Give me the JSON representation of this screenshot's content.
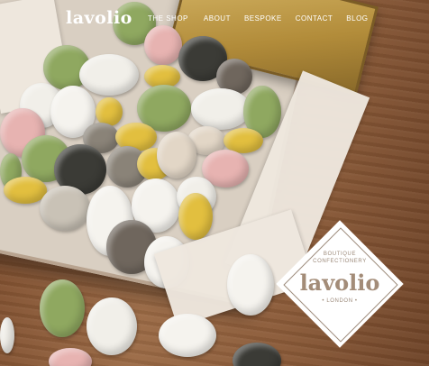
{
  "header": {
    "logo": "lavolio",
    "nav": [
      {
        "label": "THE SHOP"
      },
      {
        "label": "ABOUT"
      },
      {
        "label": "BESPOKE"
      },
      {
        "label": "CONTACT"
      },
      {
        "label": "BLOG"
      }
    ]
  },
  "badge": {
    "line1": "BOUTIQUE",
    "line2": "CONFECTIONERY",
    "logo": "lavolio",
    "city": "• LONDON •"
  },
  "colors": {
    "nav_text": "#ffffff",
    "badge_text": "#a38c78",
    "badge_background": "#ffffff"
  }
}
